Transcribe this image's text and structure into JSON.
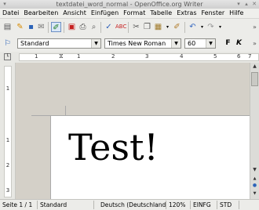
{
  "window": {
    "title": "textdatei_word_normal - OpenOffice.org Writer"
  },
  "menubar": {
    "items": [
      "Datei",
      "Bearbeiten",
      "Ansicht",
      "Einfügen",
      "Format",
      "Tabelle",
      "Extras",
      "Fenster",
      "Hilfe"
    ]
  },
  "format": {
    "paragraph_style": "Standard",
    "font_name": "Times New Roman",
    "font_size": "60",
    "bold_label": "F",
    "italic_label": "K"
  },
  "ruler": {
    "h_numbers": [
      "1",
      "1",
      "2",
      "3",
      "4",
      "5",
      "6",
      "7"
    ],
    "v_numbers": [
      "1",
      "1",
      "2",
      "3"
    ]
  },
  "document": {
    "text": "Test!"
  },
  "statusbar": {
    "page": "Seite 1 / 1",
    "style": "Standard",
    "language": "Deutsch (Deutschland)",
    "zoom": "120%",
    "insert_mode": "EINFG",
    "selection_mode": "STD"
  }
}
